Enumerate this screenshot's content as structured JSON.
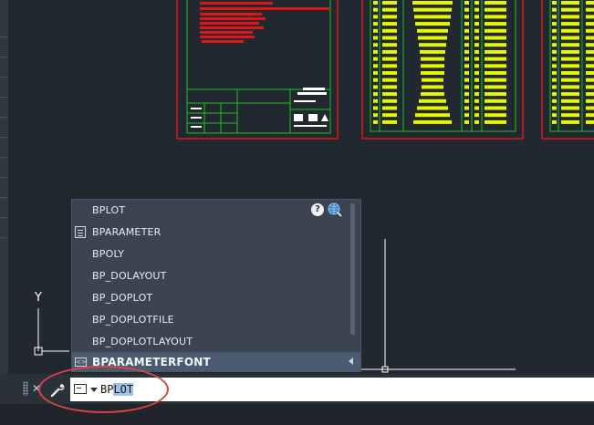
{
  "autocomplete": {
    "items": [
      {
        "label": "BPLOT",
        "icon": "none"
      },
      {
        "label": "BPARAMETER",
        "icon": "document-icon"
      },
      {
        "label": "BPOLY",
        "icon": "none"
      },
      {
        "label": "BP_DOLAYOUT",
        "icon": "none"
      },
      {
        "label": "BP_DOPLOT",
        "icon": "none"
      },
      {
        "label": "BP_DOPLOTFILE",
        "icon": "none"
      },
      {
        "label": "BP_DOPLOTLAYOUT",
        "icon": "none"
      },
      {
        "label": "BPARAMETERFONT",
        "icon": "font-icon",
        "selected": true
      }
    ],
    "help_glyph": "?"
  },
  "command_line": {
    "typed_text": "BP",
    "suggestion_text": "LOT",
    "close_glyph": "✕"
  },
  "ucs": {
    "y_label": "Y"
  },
  "colors": {
    "background": "#212830",
    "red_frame": "#e01515",
    "green_lines": "#1fbf1f",
    "yellow_fill": "#e6f500",
    "highlight_ring": "#d64545"
  }
}
